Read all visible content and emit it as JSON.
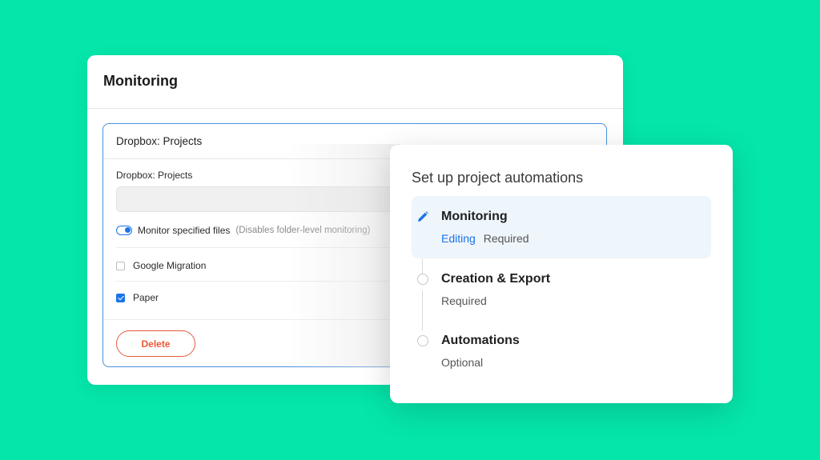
{
  "monitoring_panel": {
    "title": "Monitoring",
    "box_header": "Dropbox: Projects",
    "field_label": "Dropbox: Projects",
    "field_value": "",
    "toggle": {
      "label": "Monitor specified files",
      "note": "(Disables folder-level monitoring)",
      "on": true
    },
    "items": [
      {
        "label": "Google Migration",
        "checked": false
      },
      {
        "label": "Paper",
        "checked": true
      }
    ],
    "delete_label": "Delete"
  },
  "automation_panel": {
    "title": "Set up project automations",
    "steps": [
      {
        "name": "Monitoring",
        "status": "Editing",
        "requirement": "Required",
        "active": true,
        "icon": "pencil-icon"
      },
      {
        "name": "Creation & Export",
        "requirement": "Required",
        "active": false,
        "icon": "circle-icon"
      },
      {
        "name": "Automations",
        "requirement": "Optional",
        "active": false,
        "icon": "circle-icon"
      }
    ]
  },
  "colors": {
    "background": "#05e6aa",
    "accent": "#1a73e8",
    "danger": "#e8593c",
    "active_step_bg": "#eef5fb"
  }
}
